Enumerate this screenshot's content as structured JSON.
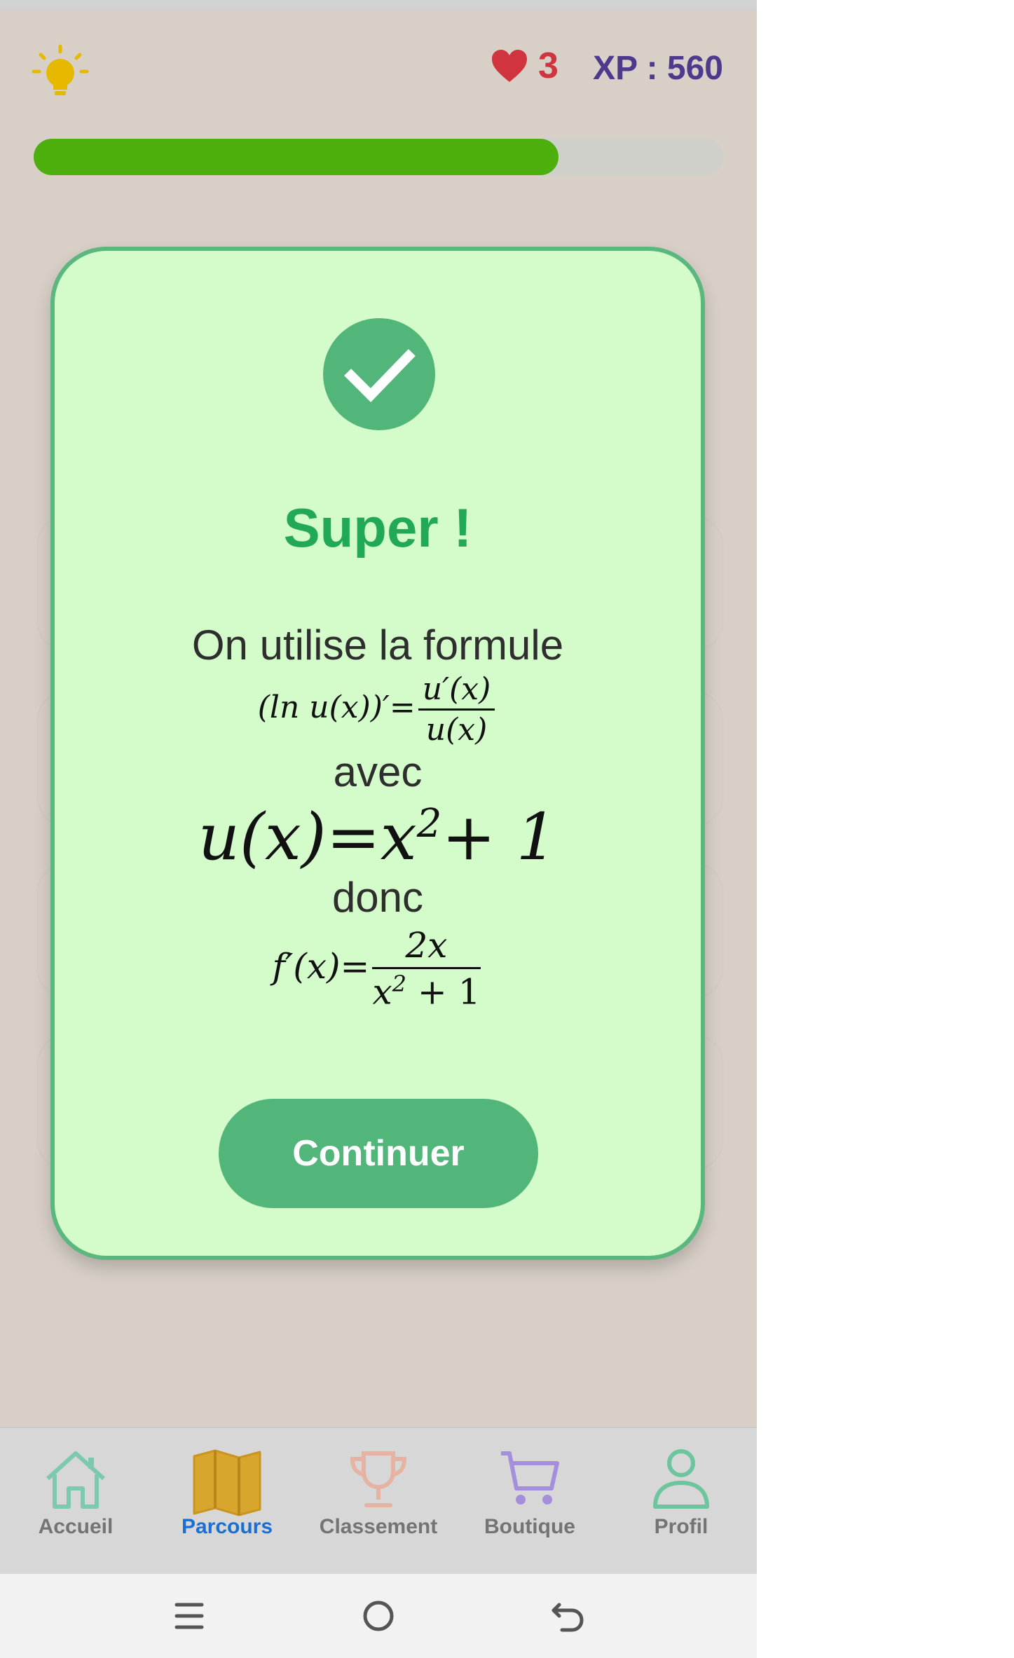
{
  "header": {
    "hint_icon": "lightbulb-icon",
    "lives_icon": "heart-icon",
    "lives": "3",
    "xp": "XP : 560"
  },
  "progress": {
    "fraction": 0.76
  },
  "modal": {
    "icon": "checkmark-icon",
    "title": "Super !",
    "line1": "On utilise la formule",
    "formula1": {
      "lhs": "(ln u(x))′=",
      "num": "u′(x)",
      "den": "u(x)"
    },
    "line2": "avec",
    "formula2": {
      "lhs": "u(x)=x",
      "exp": "2",
      "rhs": " + 1"
    },
    "line3": "donc",
    "formula3": {
      "lhs": "f′(x)=",
      "num": "2x",
      "den_base": "x",
      "den_exp": "2",
      "den_rest": " + 1"
    },
    "continue_label": "Continuer"
  },
  "nav": {
    "items": [
      {
        "label": "Accueil",
        "icon": "home-icon",
        "color": "#7cc9b0"
      },
      {
        "label": "Parcours",
        "icon": "map-icon",
        "color": "#d8a62c",
        "active": true
      },
      {
        "label": "Classement",
        "icon": "trophy-icon",
        "color": "#e6b3a2"
      },
      {
        "label": "Boutique",
        "icon": "cart-icon",
        "color": "#a58fdc"
      },
      {
        "label": "Profil",
        "icon": "person-icon",
        "color": "#6cc59d"
      }
    ]
  },
  "colors": {
    "accent_green": "#52b67a",
    "title_green": "#21a957",
    "progress_green": "#4caf0e",
    "heart_red": "#d0343f",
    "xp_purple": "#4d3a8c",
    "active_blue": "#1a6fd4"
  }
}
